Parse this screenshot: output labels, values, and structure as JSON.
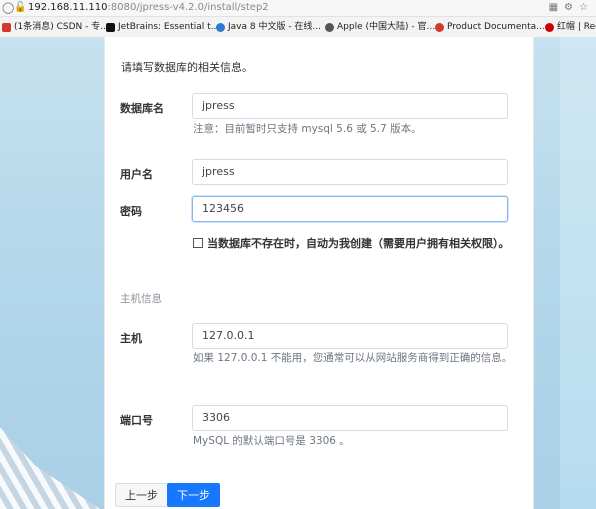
{
  "browser": {
    "url_host": "192.168.11.110",
    "url_rest": ":8080/jpress-v4.2.0/install/step2",
    "bookmarks": [
      {
        "label": "(1条消息) CSDN - 专...",
        "color": "#d0392b"
      },
      {
        "label": "JetBrains: Essential t...",
        "color": "#111111"
      },
      {
        "label": "Java 8 中文版 - 在线...",
        "color": "#2b7bd6"
      },
      {
        "label": "Apple (中国大陆) - 官...",
        "color": "#555555"
      },
      {
        "label": "Product Documenta...",
        "color": "#d0392b"
      },
      {
        "label": "红帽 | Rec",
        "color": "#cc0000"
      }
    ]
  },
  "form": {
    "intro": "请填写数据库的相关信息。",
    "db_name": {
      "label": "数据库名",
      "value": "jpress",
      "hint": "注意：目前暂时只支持 mysql 5.6 或 5.7 版本。"
    },
    "username": {
      "label": "用户名",
      "value": "jpress"
    },
    "password": {
      "label": "密码",
      "value": "123456"
    },
    "auto_create": {
      "label": "当数据库不存在时，自动为我创建（需要用户拥有相关权限）。",
      "checked": false
    },
    "host_section_title": "主机信息",
    "host": {
      "label": "主机",
      "value": "127.0.0.1",
      "hint": "如果 127.0.0.1 不能用，您通常可以从网站服务商得到正确的信息。"
    },
    "port": {
      "label": "端口号",
      "value": "3306",
      "hint": "MySQL 的默认端口号是 3306 。"
    },
    "buttons": {
      "prev": "上一步",
      "next": "下一步"
    }
  }
}
